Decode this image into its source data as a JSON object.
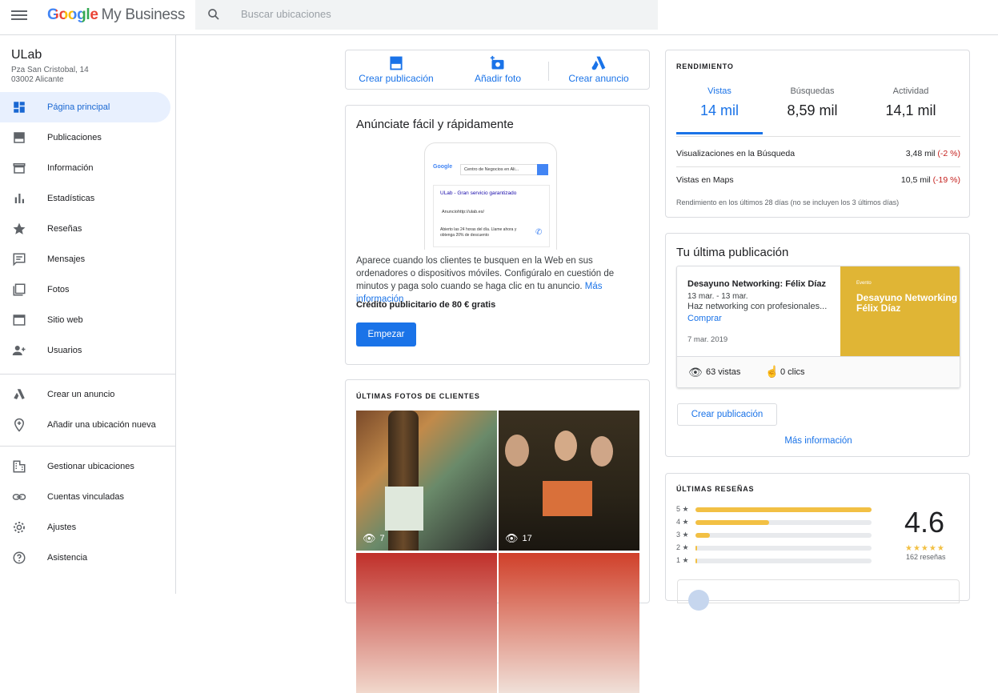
{
  "header": {
    "logo_google": "Google",
    "logo_product": "My Business",
    "search_placeholder": "Buscar ubicaciones"
  },
  "business": {
    "name": "ULab",
    "address_line1": "Pza San Cristobal, 14",
    "address_line2": "03002 Alicante"
  },
  "sidebar": {
    "items": [
      {
        "label": "Página principal",
        "icon": "dashboard-icon"
      },
      {
        "label": "Publicaciones",
        "icon": "posts-icon"
      },
      {
        "label": "Información",
        "icon": "store-icon"
      },
      {
        "label": "Estadísticas",
        "icon": "bar-chart-icon"
      },
      {
        "label": "Reseñas",
        "icon": "star-icon"
      },
      {
        "label": "Mensajes",
        "icon": "message-icon"
      },
      {
        "label": "Fotos",
        "icon": "photos-icon"
      },
      {
        "label": "Sitio web",
        "icon": "website-icon"
      },
      {
        "label": "Usuarios",
        "icon": "add-user-icon"
      }
    ],
    "secondary": [
      {
        "label": "Crear un anuncio",
        "icon": "ads-icon"
      },
      {
        "label": "Añadir una ubicación nueva",
        "icon": "add-location-icon"
      }
    ],
    "tertiary": [
      {
        "label": "Gestionar ubicaciones",
        "icon": "buildings-icon"
      },
      {
        "label": "Cuentas vinculadas",
        "icon": "link-icon"
      },
      {
        "label": "Ajustes",
        "icon": "gear-icon"
      },
      {
        "label": "Asistencia",
        "icon": "help-icon"
      }
    ]
  },
  "actions": {
    "create_post": "Crear publicación",
    "add_photo": "Añadir foto",
    "create_ad": "Crear anuncio"
  },
  "ad_card": {
    "title": "Anúnciate fácil y rápidamente",
    "mock_search_text": "Centro de Negocios en Ali...",
    "mock_google": "Google",
    "mock_result_title": "ULab - Gran servicio garantizado",
    "mock_ad_label": "Anuncio",
    "mock_url": "http://ulab.es/",
    "mock_desc": "Abierto las 24 horas del día. Llame ahora y obtenga 20% de descuento",
    "body": "Aparece cuando los clientes te busquen en la Web en sus ordenadores o dispositivos móviles. Configúralo en cuestión de minutos y paga solo cuando se haga clic en tu anuncio.",
    "more_link": "Más información",
    "credit": "Crédito publicitario de 80 € gratis",
    "start_button": "Empezar"
  },
  "photos_card": {
    "title": "ÚLTIMAS FOTOS DE CLIENTES",
    "photos": [
      {
        "views": "7"
      },
      {
        "views": "17"
      }
    ]
  },
  "performance": {
    "title": "RENDIMIENTO",
    "tabs": [
      {
        "label": "Vistas",
        "value": "14 mil"
      },
      {
        "label": "Búsquedas",
        "value": "8,59 mil"
      },
      {
        "label": "Actividad",
        "value": "14,1 mil"
      }
    ],
    "rows": [
      {
        "label": "Visualizaciones en la Búsqueda",
        "value": "3,48 mil",
        "change": "(-2 %)"
      },
      {
        "label": "Vistas en Maps",
        "value": "10,5 mil",
        "change": "(-19 %)"
      }
    ],
    "footnote": "Rendimiento en los últimos 28 días (no se incluyen los 3 últimos días)"
  },
  "last_post": {
    "title": "Tu última publicación",
    "post_title": "Desayuno Networking: Félix Díaz",
    "post_dates": "13 mar. - 13 mar.",
    "post_desc": "Haz networking con profesionales...",
    "post_cta": "Comprar",
    "post_date": "7 mar. 2019",
    "image_tag": "Evento",
    "image_title": "Desayuno Networking Félix Díaz",
    "views": "63 vistas",
    "clicks": "0 clics",
    "create_button": "Crear publicación",
    "more_link": "Más información"
  },
  "reviews": {
    "title": "ÚLTIMAS RESEÑAS",
    "score": "4.6",
    "count": "162 reseñas",
    "star_glyphs": "★★★★★",
    "bars": [
      {
        "stars": "5",
        "fraction": 1.0
      },
      {
        "stars": "4",
        "fraction": 0.42
      },
      {
        "stars": "3",
        "fraction": 0.08
      },
      {
        "stars": "2",
        "fraction": 0.0
      },
      {
        "stars": "1",
        "fraction": 0.01
      }
    ]
  },
  "colors": {
    "accent": "#1a73e8",
    "star": "#f2c044",
    "negative": "#c5221f"
  }
}
